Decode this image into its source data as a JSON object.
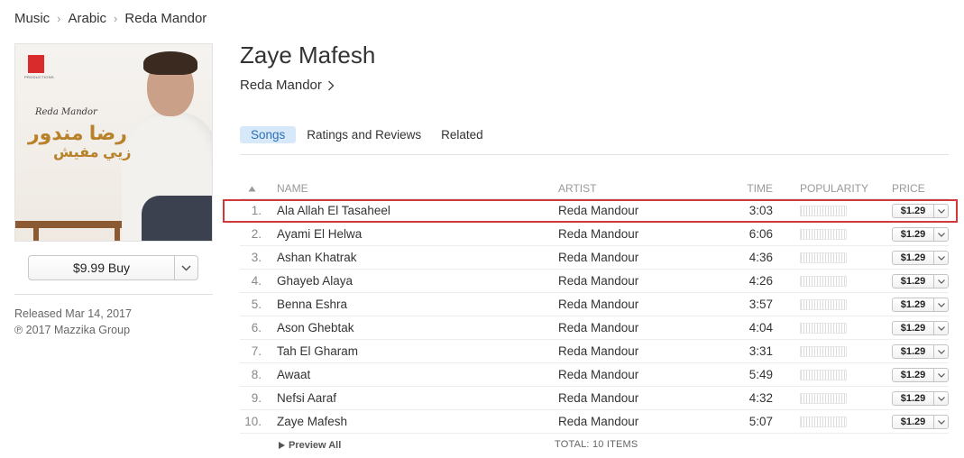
{
  "breadcrumb": [
    "Music",
    "Arabic",
    "Reda Mandor"
  ],
  "album": {
    "title": "Zaye Mafesh",
    "artist": "Reda Mandor",
    "buy_label": "$9.99 Buy",
    "released": "Released Mar 14, 2017",
    "copyright": "℗ 2017 Mazzika Group",
    "artwork": {
      "signature": "Reda Mandor",
      "arabic_title": "رضا مندور",
      "arabic_subtitle": "زيي مفيش",
      "label_caption": "PRODUCTIONS"
    }
  },
  "tabs": [
    {
      "label": "Songs",
      "active": true
    },
    {
      "label": "Ratings and Reviews",
      "active": false
    },
    {
      "label": "Related",
      "active": false
    }
  ],
  "table": {
    "headers": {
      "name": "NAME",
      "artist": "ARTIST",
      "time": "TIME",
      "popularity": "POPULARITY",
      "price": "PRICE"
    },
    "rows": [
      {
        "num": "1.",
        "name": "Ala Allah El Tasaheel",
        "artist": "Reda Mandour",
        "time": "3:03",
        "price": "$1.29",
        "highlighted": true
      },
      {
        "num": "2.",
        "name": "Ayami El Helwa",
        "artist": "Reda Mandour",
        "time": "6:06",
        "price": "$1.29"
      },
      {
        "num": "3.",
        "name": "Ashan Khatrak",
        "artist": "Reda Mandour",
        "time": "4:36",
        "price": "$1.29"
      },
      {
        "num": "4.",
        "name": "Ghayeb Alaya",
        "artist": "Reda Mandour",
        "time": "4:26",
        "price": "$1.29"
      },
      {
        "num": "5.",
        "name": "Benna Eshra",
        "artist": "Reda Mandour",
        "time": "3:57",
        "price": "$1.29"
      },
      {
        "num": "6.",
        "name": "Ason Ghebtak",
        "artist": "Reda Mandour",
        "time": "4:04",
        "price": "$1.29"
      },
      {
        "num": "7.",
        "name": "Tah El Gharam",
        "artist": "Reda Mandour",
        "time": "3:31",
        "price": "$1.29"
      },
      {
        "num": "8.",
        "name": "Awaat",
        "artist": "Reda Mandour",
        "time": "5:49",
        "price": "$1.29"
      },
      {
        "num": "9.",
        "name": "Nefsi Aaraf",
        "artist": "Reda Mandour",
        "time": "4:32",
        "price": "$1.29"
      },
      {
        "num": "10.",
        "name": "Zaye Mafesh",
        "artist": "Reda Mandour",
        "time": "5:07",
        "price": "$1.29"
      }
    ]
  },
  "footer": {
    "preview_all": "Preview All",
    "total": "TOTAL: 10 ITEMS"
  },
  "colors": {
    "tab_active_bg": "#d7e8f8",
    "tab_active_text": "#2b6fb6",
    "highlight_border": "#d0393b"
  }
}
